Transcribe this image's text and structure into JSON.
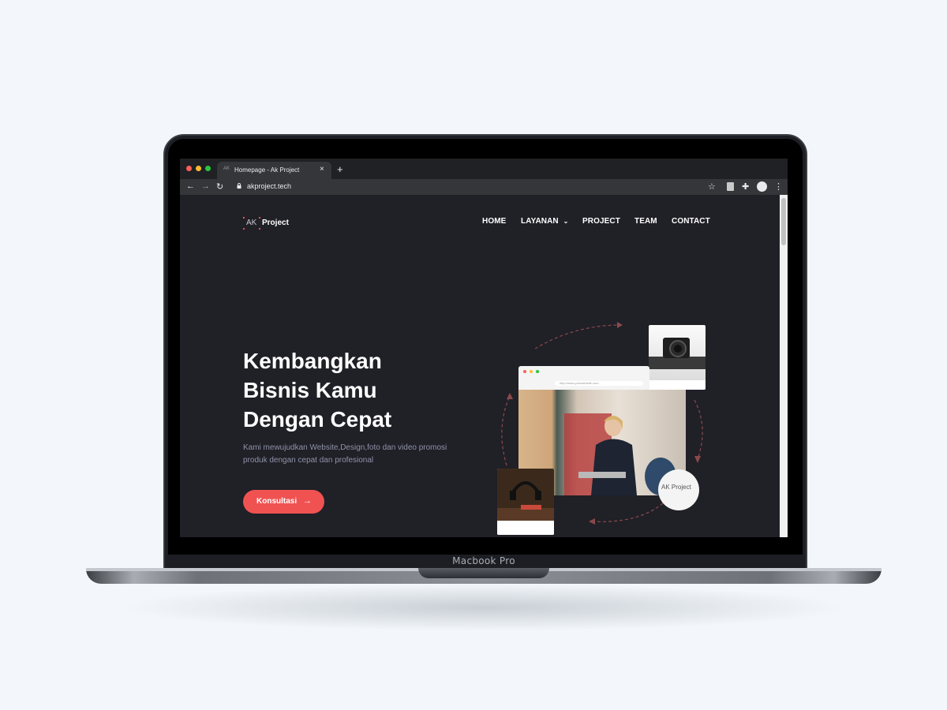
{
  "device": {
    "model_label": "Macbook Pro"
  },
  "browser": {
    "tab_title": "Homepage - Ak Project",
    "tab_favicon": "AK",
    "url": "akproject.tech",
    "traffic_lights": [
      "#ff5f57",
      "#febc2e",
      "#28c840"
    ]
  },
  "site": {
    "logo": {
      "ak": "AK",
      "project": "Project"
    },
    "nav": {
      "home": "HOME",
      "layanan": "LAYANAN",
      "project": "PROJECT",
      "team": "TEAM",
      "contact": "CONTACT"
    },
    "hero": {
      "title_line1": "Kembangkan",
      "title_line2": "Bisnis Kamu",
      "title_line3": "Dengan Cepat",
      "subtitle_line1": "Kami mewujudkan Website,Design,foto dan video promosi",
      "subtitle_line2": "produk dengan cepat dan profesional",
      "cta_label": "Konsultasi"
    },
    "illustration": {
      "mini_browser_url": "http://www.yourwebsite.com",
      "circle_logo": "AK Project"
    },
    "colors": {
      "background": "#202027",
      "accent": "#f05252",
      "subtitle": "#8e93a8"
    }
  }
}
